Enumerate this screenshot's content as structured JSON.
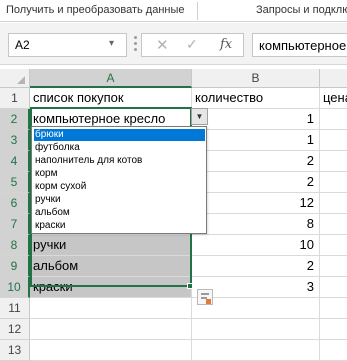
{
  "ribbon": {
    "tab1": "Получить и преобразовать данные",
    "tab2": "Запросы и подклю"
  },
  "formula_bar": {
    "name_box": "A2",
    "name_box_arrow": "▾",
    "cancel_glyph": "✕",
    "enter_glyph": "✓",
    "fx_label": "fx",
    "content": "компьютерное кресло"
  },
  "columns": [
    "A",
    "B"
  ],
  "rows": [
    {
      "n": "1",
      "a": "список покупок",
      "b": "количество",
      "c": "цена"
    },
    {
      "n": "2",
      "a": "компьютерное кресло",
      "b": "1"
    },
    {
      "n": "3",
      "a": "",
      "b": "1"
    },
    {
      "n": "4",
      "a": "",
      "b": "2"
    },
    {
      "n": "5",
      "a": "",
      "b": "2"
    },
    {
      "n": "6",
      "a": "",
      "b": "12"
    },
    {
      "n": "7",
      "a": "",
      "b": "8"
    },
    {
      "n": "8",
      "a": "ручки",
      "b": "10"
    },
    {
      "n": "9",
      "a": "альбом",
      "b": "2"
    },
    {
      "n": "10",
      "a": "краски",
      "b": "3"
    },
    {
      "n": "11",
      "a": "",
      "b": ""
    },
    {
      "n": "12",
      "a": "",
      "b": ""
    },
    {
      "n": "13",
      "a": "",
      "b": ""
    }
  ],
  "dropdown": {
    "arrow": "▼",
    "items": [
      "брюки",
      "футболка",
      "наполнитель для котов",
      "корм",
      "корм сухой",
      "ручки",
      "альбом",
      "краски"
    ],
    "highlighted_index": 0
  },
  "colors": {
    "accent_green": "#217346",
    "selection_fill": "#c6c6c6",
    "list_highlight": "#0078d7"
  },
  "icons": {
    "quick_analysis": "quick-analysis-icon"
  }
}
